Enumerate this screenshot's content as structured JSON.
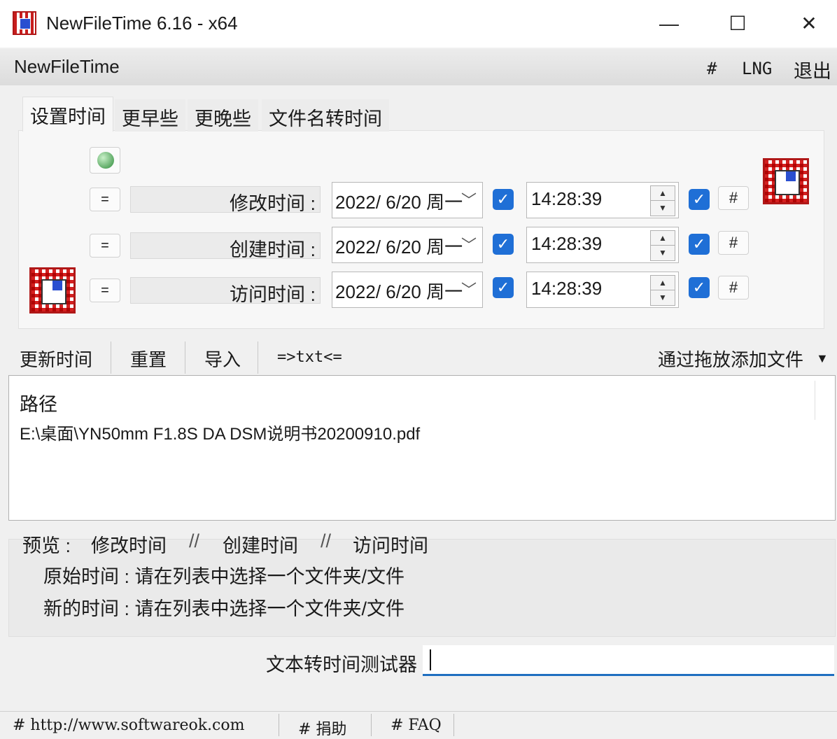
{
  "window": {
    "title": "NewFileTime 6.16 - x64",
    "minimize": "—",
    "maximize": "☐",
    "close": "✕"
  },
  "menu": {
    "left": "NewFileTime",
    "hash": "#",
    "lng": "LNG",
    "exit": "退出"
  },
  "tabs": [
    {
      "label": "设置时间",
      "active": true
    },
    {
      "label": "更早些"
    },
    {
      "label": "更晚些"
    },
    {
      "label": "文件名转时间"
    }
  ],
  "rows": [
    {
      "equals": "=",
      "label": "修改时间 :",
      "date": "2022/  6/20 周一",
      "time": "14:28:39",
      "hash": "#"
    },
    {
      "equals": "=",
      "label": "创建时间 :",
      "date": "2022/  6/20 周一",
      "time": "14:28:39",
      "hash": "#"
    },
    {
      "equals": "=",
      "label": "访问时间 :",
      "date": "2022/  6/20 周一",
      "time": "14:28:39",
      "hash": "#"
    }
  ],
  "toolbar": {
    "update": "更新时间",
    "reset": "重置",
    "import": "导入",
    "txt": "=>txt<=",
    "drop": "通过拖放添加文件",
    "drop_arrow": "▼"
  },
  "list": {
    "header": "路径",
    "items": [
      "E:\\桌面\\YN50mm F1.8S DA DSM说明书20200910.pdf"
    ]
  },
  "preview": {
    "heading_prefix": "预览 :",
    "col1": "修改时间",
    "slash1": "//",
    "col2": "创建时间",
    "slash2": "//",
    "col3": "访问时间",
    "original": "原始时间 : 请在列表中选择一个文件夹/文件",
    "new": "新的时间 : 请在列表中选择一个文件夹/文件"
  },
  "tester": {
    "label": "文本转时间测试器",
    "value": ""
  },
  "status": {
    "url": "# http://www.softwareok.com",
    "donate": "# 捐助",
    "faq": "# FAQ"
  },
  "colors": {
    "accent": "#1f6fd6",
    "icon_red": "#d42020"
  }
}
